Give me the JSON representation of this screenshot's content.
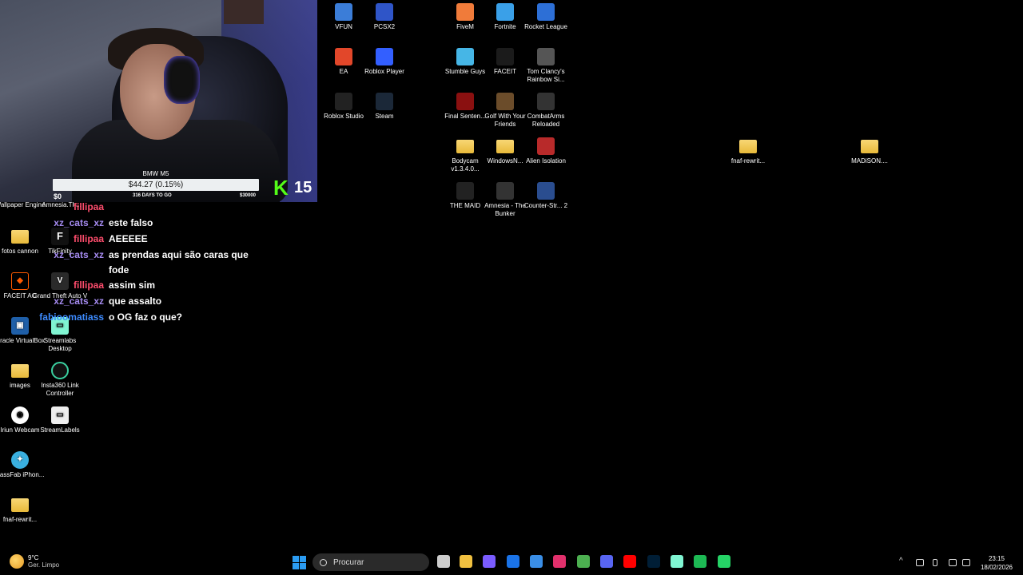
{
  "stream_overlay": {
    "goal_title": "BMW M5",
    "goal_amount": "$44.27 (0.15%)",
    "goal_start": "$0",
    "goal_days": "316 DAYS TO GO",
    "goal_end": "$30000",
    "kick_count": "15"
  },
  "chat": [
    {
      "user": "fillipaa",
      "text": "",
      "color": "#ff4d6d"
    },
    {
      "user": "xz_cats_xz",
      "text": "este falso",
      "color": "#a58bf0"
    },
    {
      "user": "fillipaa",
      "text": "AEEEEE",
      "color": "#ff4d6d"
    },
    {
      "user": "xz_cats_xz",
      "text": "as prendas aqui são caras que fode",
      "color": "#a58bf0"
    },
    {
      "user": "fillipaa",
      "text": "assim sim",
      "color": "#ff4d6d"
    },
    {
      "user": "xz_cats_xz",
      "text": "que assalto",
      "color": "#a58bf0"
    },
    {
      "user": "fabioomatiass",
      "text": "o OG faz o que?",
      "color": "#3d8bff"
    }
  ],
  "desktop_icons": {
    "left_column": [
      {
        "label": "Wallpaper Engine",
        "icon": "wallpaper-engine-icon"
      },
      {
        "label": "fotos cannon",
        "icon": "folder-icon"
      },
      {
        "label": "FACEIT AC",
        "icon": "faceit-ac-icon"
      },
      {
        "label": "Oracle VirtualBox",
        "icon": "virtualbox-icon"
      },
      {
        "label": "images",
        "icon": "folder-icon"
      },
      {
        "label": "Iriun Webcam",
        "icon": "iriun-icon"
      },
      {
        "label": "PassFab iPhon...",
        "icon": "passfab-icon"
      },
      {
        "label": "fnaf-rewrit...",
        "icon": "folder-icon"
      }
    ],
    "second_column": [
      {
        "label": "Amnesia.Th...",
        "icon": "amnesia-icon"
      },
      {
        "label": "TikFinity",
        "icon": "tikfinity-icon"
      },
      {
        "label": "Grand Theft Auto V",
        "icon": "gta-icon"
      },
      {
        "label": "Streamlabs Desktop",
        "icon": "streamlabs-icon"
      },
      {
        "label": "Insta360 Link Controller",
        "icon": "insta360-icon"
      },
      {
        "label": "StreamLabels",
        "icon": "streamlabels-icon"
      }
    ],
    "grid": [
      {
        "label": "VFUN",
        "icon": "vfun-icon",
        "color": "#3b7dd8"
      },
      {
        "label": "PCSX2",
        "icon": "pcsx2-icon",
        "color": "#2f55c8"
      },
      {
        "label": "FiveM",
        "icon": "fivem-icon",
        "color": "#f07b3a"
      },
      {
        "label": "Fortnite",
        "icon": "fortnite-icon",
        "color": "#3aa0e8"
      },
      {
        "label": "Rocket League",
        "icon": "rocket-league-icon",
        "color": "#2d6fd6"
      },
      {
        "label": "EA",
        "icon": "ea-icon",
        "color": "#e2472a"
      },
      {
        "label": "Roblox Player",
        "icon": "roblox-icon",
        "color": "#335fff"
      },
      {
        "label": "Stumble Guys",
        "icon": "stumble-guys-icon",
        "color": "#46b6e6"
      },
      {
        "label": "FACEIT",
        "icon": "faceit-icon",
        "color": "#1b1b1b"
      },
      {
        "label": "Tom Clancy's Rainbow Si...",
        "icon": "rainbow-six-icon",
        "color": "#555555"
      },
      {
        "label": "Roblox Studio",
        "icon": "roblox-studio-icon",
        "color": "#222222"
      },
      {
        "label": "Steam",
        "icon": "steam-icon",
        "color": "#1b2838"
      },
      {
        "label": "Final Senten...",
        "icon": "final-sentence-icon",
        "color": "#8a1010"
      },
      {
        "label": "Golf With Your Friends",
        "icon": "golf-icon",
        "color": "#6b4c2a"
      },
      {
        "label": "CombatArms Reloaded",
        "icon": "combat-arms-icon",
        "color": "#333333"
      },
      {
        "label": "Bodycam v1.3.4.0...",
        "icon": "folder-icon",
        "color": "#e8b93a"
      },
      {
        "label": "WindowsN...",
        "icon": "folder-icon",
        "color": "#e8b93a"
      },
      {
        "label": "Alien Isolation",
        "icon": "alien-icon",
        "color": "#b82a2a"
      },
      {
        "label": "THE MAID",
        "icon": "the-maid-icon",
        "color": "#222222"
      },
      {
        "label": "Amnesia - The Bunker",
        "icon": "amnesia-bunker-icon",
        "color": "#333333"
      },
      {
        "label": "Counter-Str... 2",
        "icon": "cs2-icon",
        "color": "#2a4d8f"
      },
      {
        "label": "fnaf-rewrit...",
        "icon": "folder-icon",
        "color": "#e8b93a"
      },
      {
        "label": "MADiSON....",
        "icon": "folder-icon",
        "color": "#e8b93a"
      }
    ]
  },
  "taskbar": {
    "weather_temp": "9°C",
    "weather_condition": "Ger. Limpo",
    "search_placeholder": "Procurar",
    "time": "23:15",
    "date": "18/02/2026",
    "apps": [
      {
        "name": "task-view-icon",
        "color": "#cccccc"
      },
      {
        "name": "file-explorer-icon",
        "color": "#f0c040"
      },
      {
        "name": "copilot-icon",
        "color": "#7a5cff"
      },
      {
        "name": "outlook-icon",
        "color": "#1a73e8"
      },
      {
        "name": "store-icon",
        "color": "#3a8ee6"
      },
      {
        "name": "instagram-icon",
        "color": "#e1306c"
      },
      {
        "name": "chrome-icon",
        "color": "#4caf50"
      },
      {
        "name": "discord-icon",
        "color": "#5865f2"
      },
      {
        "name": "youtube-icon",
        "color": "#ff0000"
      },
      {
        "name": "photoshop-icon",
        "color": "#001e36"
      },
      {
        "name": "streamlabs-icon",
        "color": "#80f5d2"
      },
      {
        "name": "spotify-icon",
        "color": "#1db954"
      },
      {
        "name": "whatsapp-icon",
        "color": "#25d366"
      }
    ]
  }
}
